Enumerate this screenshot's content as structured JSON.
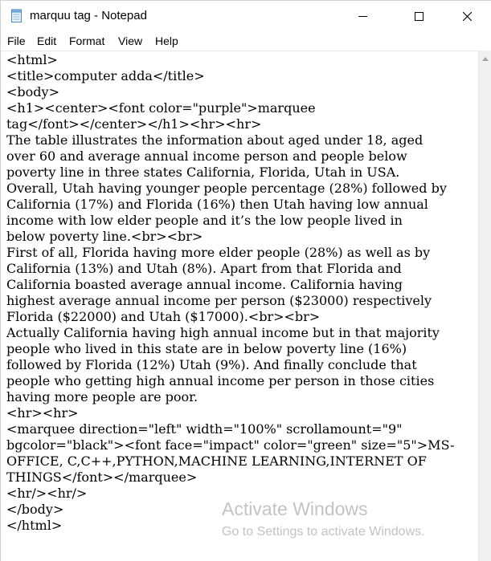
{
  "window": {
    "title": "marquu tag - Notepad",
    "icons": {
      "app": "notepad-icon",
      "minimize": "minimize-icon",
      "maximize": "maximize-icon",
      "close": "close-icon"
    }
  },
  "menu": [
    "File",
    "Edit",
    "Format",
    "View",
    "Help"
  ],
  "editor": {
    "lines": [
      "<html>",
      "<title>computer adda</title>",
      "<body>",
      "<h1><center><font color=\"purple\">marquee",
      "tag</font></center></h1><hr><hr>",
      "The table illustrates the information about aged under 18, aged",
      "over 60 and average annual income person and people below",
      "poverty line in three states California, Florida, Utah in USA.",
      "Overall, Utah having younger people percentage (28%) followed by",
      "California (17%) and Florida (16%) then Utah having low annual",
      "income with low elder people and it’s the low people lived in",
      "below poverty line.<br><br>",
      "First of all, Florida having more elder people (28%) as well as by",
      "California (13%) and Utah (8%). Apart from that Florida and",
      "California boasted average annual income. California having",
      "highest average annual income per person ($23000) respectively",
      "Florida ($22000) and Utah ($17000).<br><br>",
      "Actually California having high annual income but in that majority",
      "people who lived in this state are in below poverty line (16%)",
      "followed by Florida (12%) Utah (9%). And finally conclude that",
      "people who getting high annual income per person in those cities",
      "having more people are poor.",
      "<hr><hr>",
      "<marquee direction=\"left\" width=\"100%\" scrollamount=\"9\"",
      "bgcolor=\"black\"><font face=\"impact\" color=\"green\" size=\"5\">MS-",
      "OFFICE, C,C++,PYTHON,MACHINE LEARNING,INTERNET OF",
      "THINGS</font></marquee>",
      "<hr/><hr/>",
      "</body>",
      "</html>"
    ]
  },
  "watermark": {
    "title": "Activate Windows",
    "subtitle": "Go to Settings to activate Windows."
  }
}
